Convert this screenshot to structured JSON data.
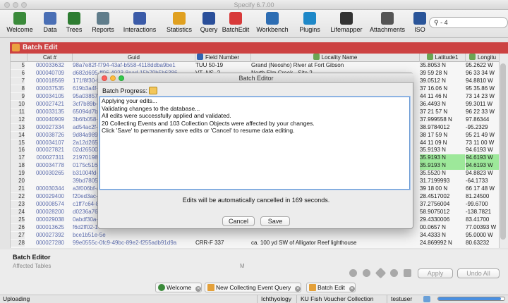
{
  "window": {
    "title": "Specify 6.7.00"
  },
  "toolbar": {
    "items": [
      {
        "label": "Welcome",
        "icon": "specify-logo-icon",
        "color": "#3a8a3a"
      },
      {
        "label": "Data",
        "icon": "data-icon",
        "color": "#4a6fb5"
      },
      {
        "label": "Trees",
        "icon": "trees-icon",
        "color": "#2e7d32"
      },
      {
        "label": "Reports",
        "icon": "reports-icon",
        "color": "#607d8b"
      },
      {
        "label": "Interactions",
        "icon": "interactions-icon",
        "color": "#3b5ba8"
      },
      {
        "label": "Statistics",
        "icon": "statistics-icon",
        "color": "#e0a020"
      },
      {
        "label": "Query",
        "icon": "query-icon",
        "color": "#2a4f9a"
      },
      {
        "label": "BatchEdit",
        "icon": "batchedit-icon",
        "color": "#d83a3a"
      },
      {
        "label": "Workbench",
        "icon": "workbench-icon",
        "color": "#2d6db3"
      },
      {
        "label": "Plugins",
        "icon": "plugins-icon",
        "color": "#1e88c8"
      },
      {
        "label": "Lifemapper",
        "icon": "lifemapper-icon",
        "color": "#333333"
      },
      {
        "label": "Attachments",
        "icon": "attachments-icon",
        "color": "#555555"
      },
      {
        "label": "ISO",
        "icon": "iso-icon",
        "color": "#2a5599"
      }
    ],
    "search_value": "- 4"
  },
  "batch_edit_tab": {
    "title": "Batch Edit"
  },
  "table": {
    "columns": [
      "Cat #",
      "Guid",
      "Field Number",
      "Locality Name",
      "Latitude1",
      "Longitu"
    ],
    "rows": [
      {
        "rn": "5",
        "cat": "000033632",
        "guid": "98a7e82f-f794-43af-b558-4118ddba9be1",
        "fnum": "TUU 50-19",
        "loc": "Grand (Neosho) River at Fort Gibson",
        "lat": "35.8053 N",
        "lon": "95.2622 W"
      },
      {
        "rn": "6",
        "cat": "000040709",
        "guid": "d682d695-ff06-4023-8ead-15b79b5b6386",
        "fnum": "VT- NS- 2",
        "loc": "North Elm Creek - Site 2",
        "lat": "39 59 28 N",
        "lon": "96 33 34 W"
      },
      {
        "rn": "7",
        "cat": "000018569",
        "guid": "171f8f30-ffa",
        "fnum": "",
        "loc": "",
        "lat": "39.0512 N",
        "lon": "94.8810 W"
      },
      {
        "rn": "8",
        "cat": "000037535",
        "guid": "619b3a4f-38",
        "fnum": "",
        "loc": "",
        "lat": "37 16.06 N",
        "lon": "95 35.86 W"
      },
      {
        "rn": "9",
        "cat": "000034105",
        "guid": "95a03857-3f",
        "fnum": "",
        "loc": "",
        "lat": "44 11 46 N",
        "lon": "73 14 23 W"
      },
      {
        "rn": "10",
        "cat": "000027421",
        "guid": "3cf7b89b-58",
        "fnum": "",
        "loc": "",
        "lat": "36.4493 N",
        "lon": "99.3011 W"
      },
      {
        "rn": "11",
        "cat": "000033135",
        "guid": "65094d7b-1",
        "fnum": "",
        "loc": "",
        "lat": "37 21 57 N",
        "lon": "96 22 33 W"
      },
      {
        "rn": "12",
        "cat": "000040909",
        "guid": "3b6fb058-54",
        "fnum": "",
        "loc": "",
        "lat": "37.999558 N",
        "lon": "97.86344"
      },
      {
        "rn": "13",
        "cat": "000027334",
        "guid": "ad54ac2f-3d",
        "fnum": "",
        "loc": "",
        "lat": "38.9784012",
        "lon": "-95.2329"
      },
      {
        "rn": "14",
        "cat": "000038726",
        "guid": "9d84a989-27",
        "fnum": "",
        "loc": "",
        "lat": "38 17 59 N",
        "lon": "95 21 49 W"
      },
      {
        "rn": "15",
        "cat": "000034107",
        "guid": "2a12d265-5b",
        "fnum": "",
        "loc": "",
        "lat": "44 11 09 N",
        "lon": "73 11 00 W"
      },
      {
        "rn": "16",
        "cat": "000027821",
        "guid": "02d26500-22",
        "fnum": "",
        "loc": "",
        "lat": "35.9193 N",
        "lon": "94.6193 W"
      },
      {
        "rn": "17",
        "cat": "000027311",
        "guid": "21970198-23",
        "fnum": "",
        "loc": "",
        "lat": "35.9193 N",
        "lon": "94.6193 W"
      },
      {
        "rn": "18",
        "cat": "000034778",
        "guid": "0175c516-a5",
        "fnum": "",
        "loc": "",
        "lat": "35.9193 N",
        "lon": "94.6193 W"
      },
      {
        "rn": "19",
        "cat": "000030265",
        "guid": "b31004fd-3a",
        "fnum": "",
        "loc": "",
        "lat": "35.5520 N",
        "lon": "94.8823 W"
      },
      {
        "rn": "20",
        "cat": "",
        "guid": "39bd7805-d",
        "fnum": "",
        "loc": "",
        "lat": "31.7199993",
        "lon": "-64.1733"
      },
      {
        "rn": "21",
        "cat": "000030344",
        "guid": "a3f006bf-ac",
        "fnum": "",
        "loc": "",
        "lat": "39 18 00 N",
        "lon": "66 17 48 W"
      },
      {
        "rn": "22",
        "cat": "000029400",
        "guid": "f20ed3ac-43",
        "fnum": "",
        "loc": "",
        "lat": "28.4517002",
        "lon": "81.24500"
      },
      {
        "rn": "23",
        "cat": "000008574",
        "guid": "c1ff7c64-88",
        "fnum": "",
        "loc": "",
        "lat": "37.2756004",
        "lon": "-99.6700"
      },
      {
        "rn": "24",
        "cat": "000028200",
        "guid": "d0236a76-20",
        "fnum": "",
        "loc": "",
        "lat": "58.9075012",
        "lon": "-138.7821"
      },
      {
        "rn": "25",
        "cat": "000029038",
        "guid": "0abdf30a-89",
        "fnum": "",
        "loc": "",
        "lat": "29.4330006",
        "lon": "83.41700"
      },
      {
        "rn": "26",
        "cat": "000013625",
        "guid": "f6d2ff02-17",
        "fnum": "",
        "loc": "",
        "lat": "00.0657 N",
        "lon": "77.00393 W"
      },
      {
        "rn": "27",
        "cat": "000027392",
        "guid": "bce1b51e-5e",
        "fnum": "",
        "loc": "",
        "lat": "34.4333 N",
        "lon": "95.0000 W"
      },
      {
        "rn": "28",
        "cat": "000027280",
        "guid": "99e0555c-0fc9-49bc-89e2-f255adb91d9a",
        "fnum": "CRR-F 337",
        "loc": "ca. 100 yd SW of Alligator Reef lighthouse",
        "lat": "24.869992 N",
        "lon": "80.63232"
      }
    ]
  },
  "batch_editor": {
    "title": "Batch Editor",
    "subtitle": "Affected Tables",
    "sub_right": "M"
  },
  "buttons": {
    "apply": "Apply",
    "undo_all": "Undo All"
  },
  "bottom_tabs": [
    {
      "label": "Welcome",
      "icon": "specify-logo-icon"
    },
    {
      "label": "New Collecting Event Query",
      "icon": "pencil-icon"
    },
    {
      "label": "Batch Edit",
      "icon": "pencil-icon"
    }
  ],
  "status": {
    "left": "Uploading",
    "discipline": "Ichthyology",
    "collection": "KU Fish Voucher Collection",
    "user": "testuser",
    "progress": 0.95
  },
  "dialog": {
    "title": "Batch Editor",
    "progress_label": "Batch Progress:",
    "lines": [
      "Applying your edits...",
      "Validating changes to the database...",
      "All edits were successfully applied and validated.",
      "20 Collecting Events and 103 Collection Objects were affected by your changes.",
      "Click 'Save' to permanently save edits or 'Cancel' to resume data editing."
    ],
    "countdown_text": "Edits will be automatically cancelled in 169 seconds.",
    "cancel": "Cancel",
    "save": "Save"
  }
}
